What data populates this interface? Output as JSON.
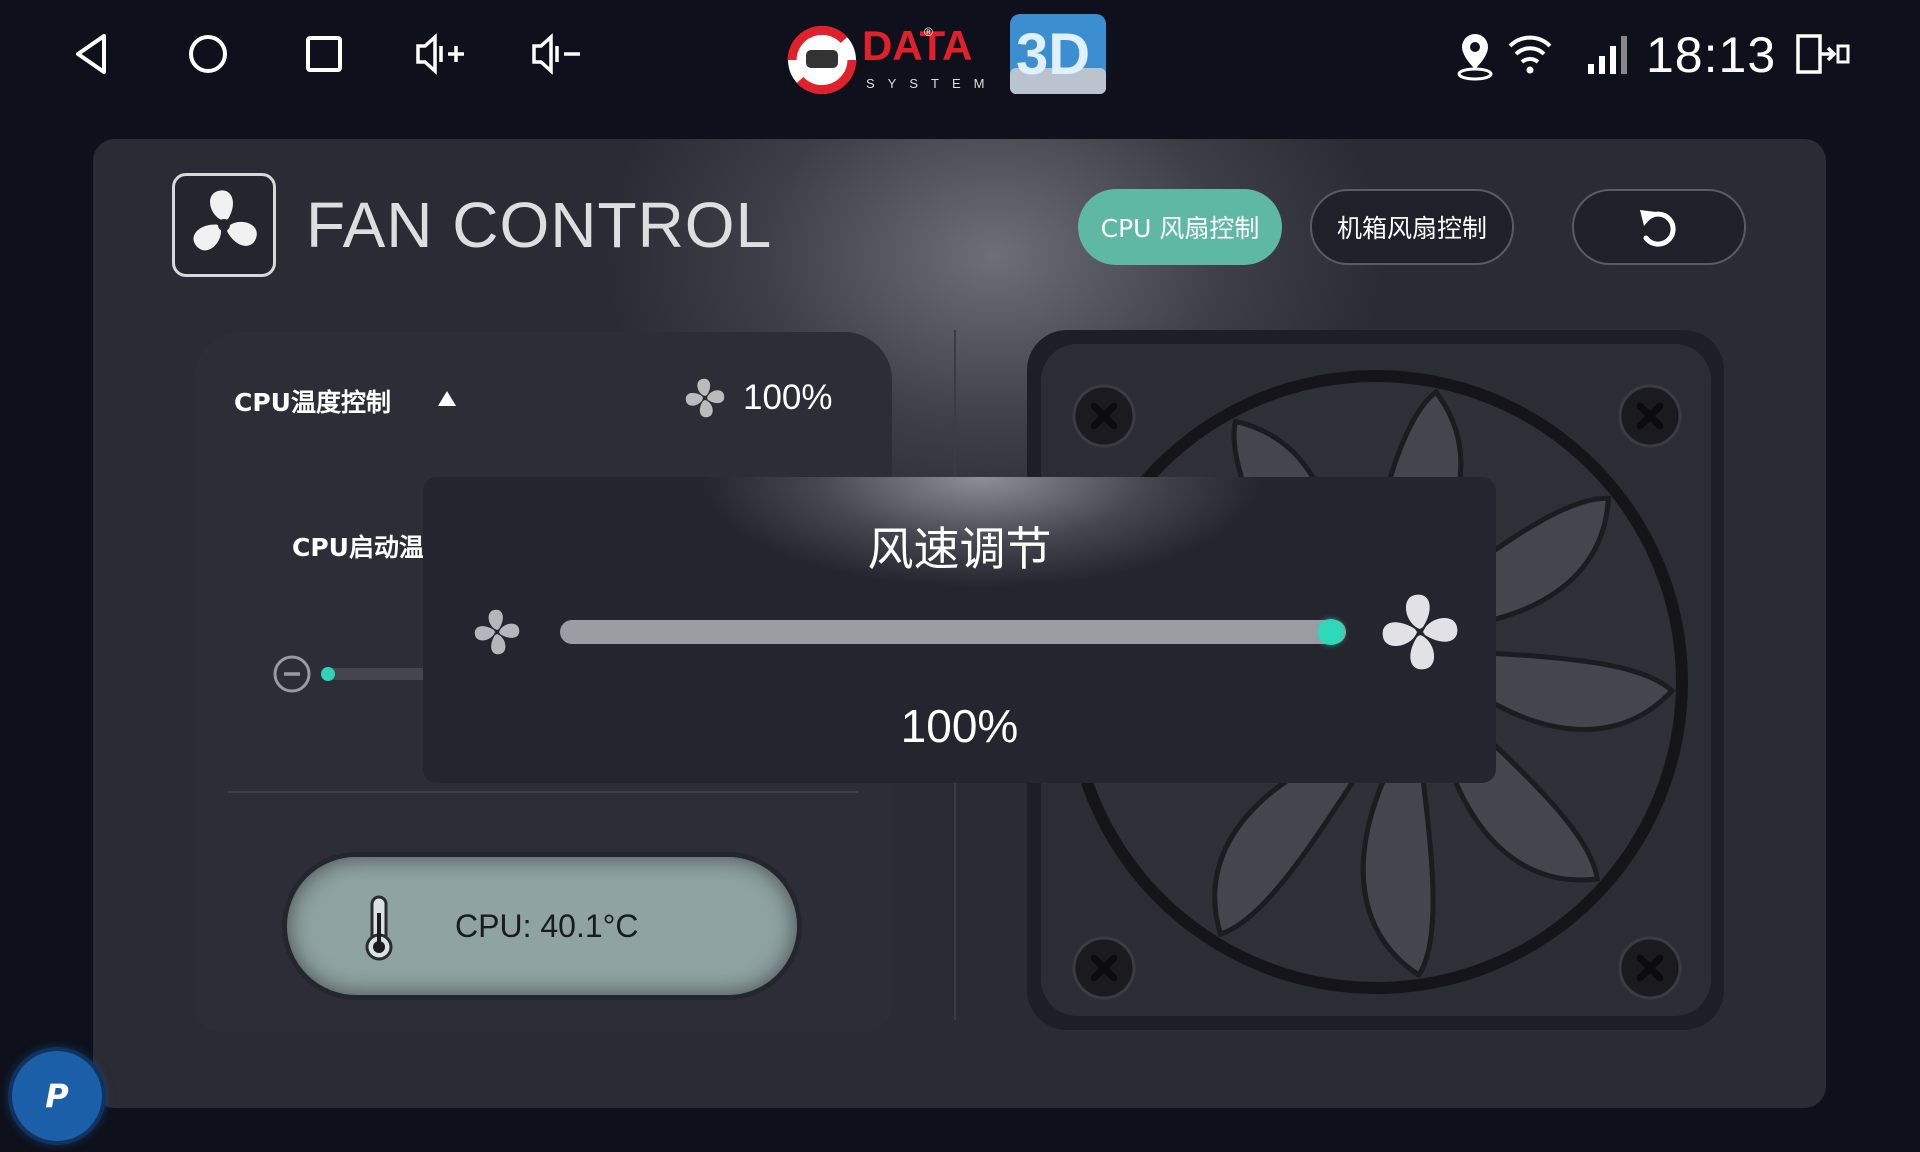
{
  "status_bar": {
    "time": "18:13",
    "nav_icons": [
      "back-icon",
      "home-icon",
      "recents-icon",
      "volume-up-icon",
      "volume-down-icon"
    ],
    "right_icons": [
      "location-icon",
      "wifi-icon",
      "signal-icon",
      "screen-switch-icon"
    ],
    "logo_text": "DATA",
    "logo_sub": "SYSTEM",
    "logo_badge": "3D"
  },
  "header": {
    "title": "FAN CONTROL",
    "tabs": [
      {
        "label": "CPU 风扇控制",
        "active": true
      },
      {
        "label": "机箱风扇控制",
        "active": false
      }
    ],
    "back_icon": "undo-icon"
  },
  "cpu_panel": {
    "section_label": "CPU温度控制",
    "fan_speed": "100%",
    "start_temp_label": "CPU启动温",
    "temperature": "CPU: 40.1°C"
  },
  "dialog": {
    "title": "风速调节",
    "value_text": "100%",
    "slider_level": 1.0
  },
  "floating_button": {
    "label": "P"
  },
  "colors": {
    "accent": "#5fb8a3",
    "slider_thumb": "#2fd8b9",
    "background": "#0e111c",
    "panel": "#2a2b34"
  }
}
